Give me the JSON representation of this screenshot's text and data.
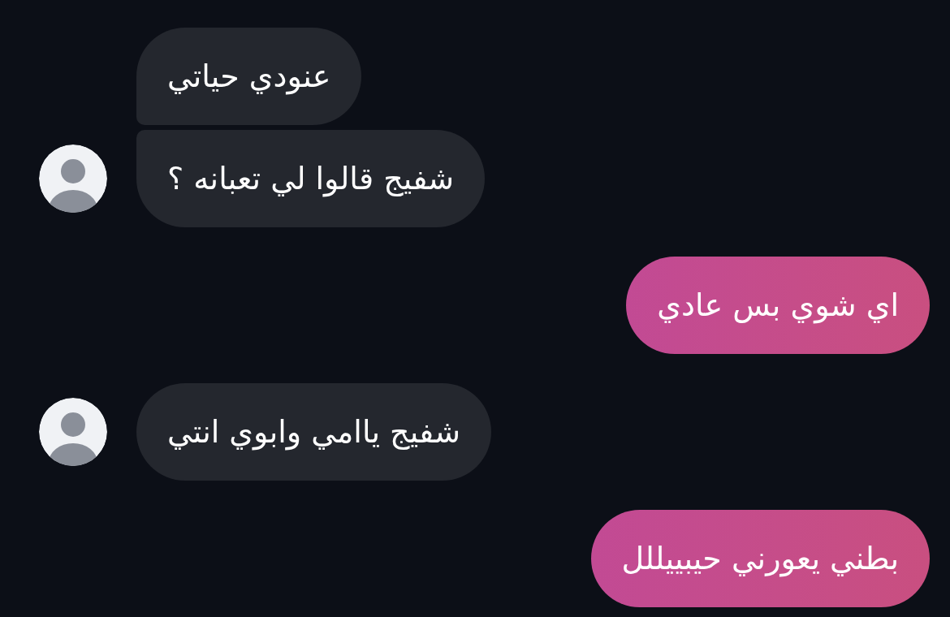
{
  "groups": [
    {
      "kind": "incoming",
      "messages": [
        "عنودي حياتي",
        "شفيج قالوا لي تعبانه ؟"
      ]
    },
    {
      "kind": "outgoing",
      "messages": [
        "اي شوي بس عادي"
      ]
    },
    {
      "kind": "incoming",
      "messages": [
        "شفيج ياامي وابوي انتي"
      ]
    },
    {
      "kind": "outgoing",
      "messages": [
        "بطني يعورني حيبييللل"
      ]
    }
  ]
}
